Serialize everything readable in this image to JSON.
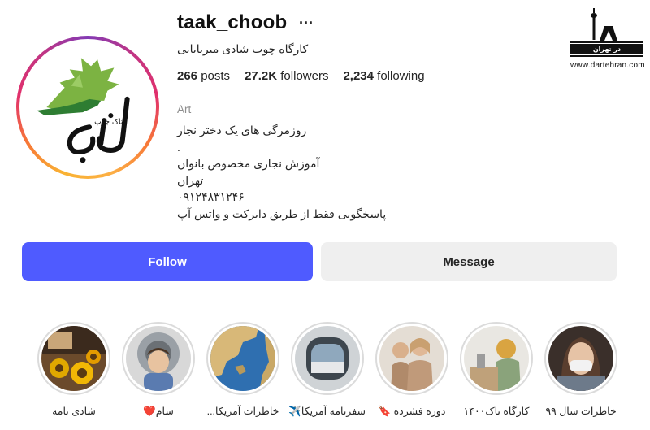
{
  "profile": {
    "username": "taak_choob",
    "more_label": "···",
    "full_name": "کارگاه چوب شادی میربابایی",
    "stats": {
      "posts_count": "266",
      "posts_label": "posts",
      "followers_count": "27.2K",
      "followers_label": "followers",
      "following_count": "2,234",
      "following_label": "following"
    },
    "category": "Art",
    "bio_lines": [
      "روزمرگی های یک دختر نجار",
      ".",
      "آموزش نجاری مخصوص بانوان",
      "تهران",
      "۰۹۱۲۴۸۳۱۲۴۶",
      "پاسخگویی فقط از طریق دایرکت و واتس آپ"
    ],
    "avatar_logo_text": "تاک چوب"
  },
  "watermark": {
    "logo_text": "در تهران",
    "url": "www.dartehran.com"
  },
  "actions": {
    "follow_label": "Follow",
    "message_label": "Message"
  },
  "highlights": [
    {
      "label": "شادی نامه",
      "icon": "sunflowers-photo"
    },
    {
      "label": "سام❤️",
      "icon": "baby-photo"
    },
    {
      "label": "خاطرات آمریکا...",
      "icon": "map-photo"
    },
    {
      "label": "سفرنامه آمریکا✈️",
      "icon": "window-photo"
    },
    {
      "label": "دوره فشرده 🔖",
      "icon": "women-photo"
    },
    {
      "label": "کارگاه تاک۱۴۰۰",
      "icon": "workshop-photo"
    },
    {
      "label": "خاطرات سال ۹۹",
      "icon": "mask-photo"
    }
  ],
  "colors": {
    "follow_button": "#4f5bff",
    "message_button": "#efefef",
    "logo_green": "#7cb342",
    "logo_dark_green": "#2e7d32"
  }
}
